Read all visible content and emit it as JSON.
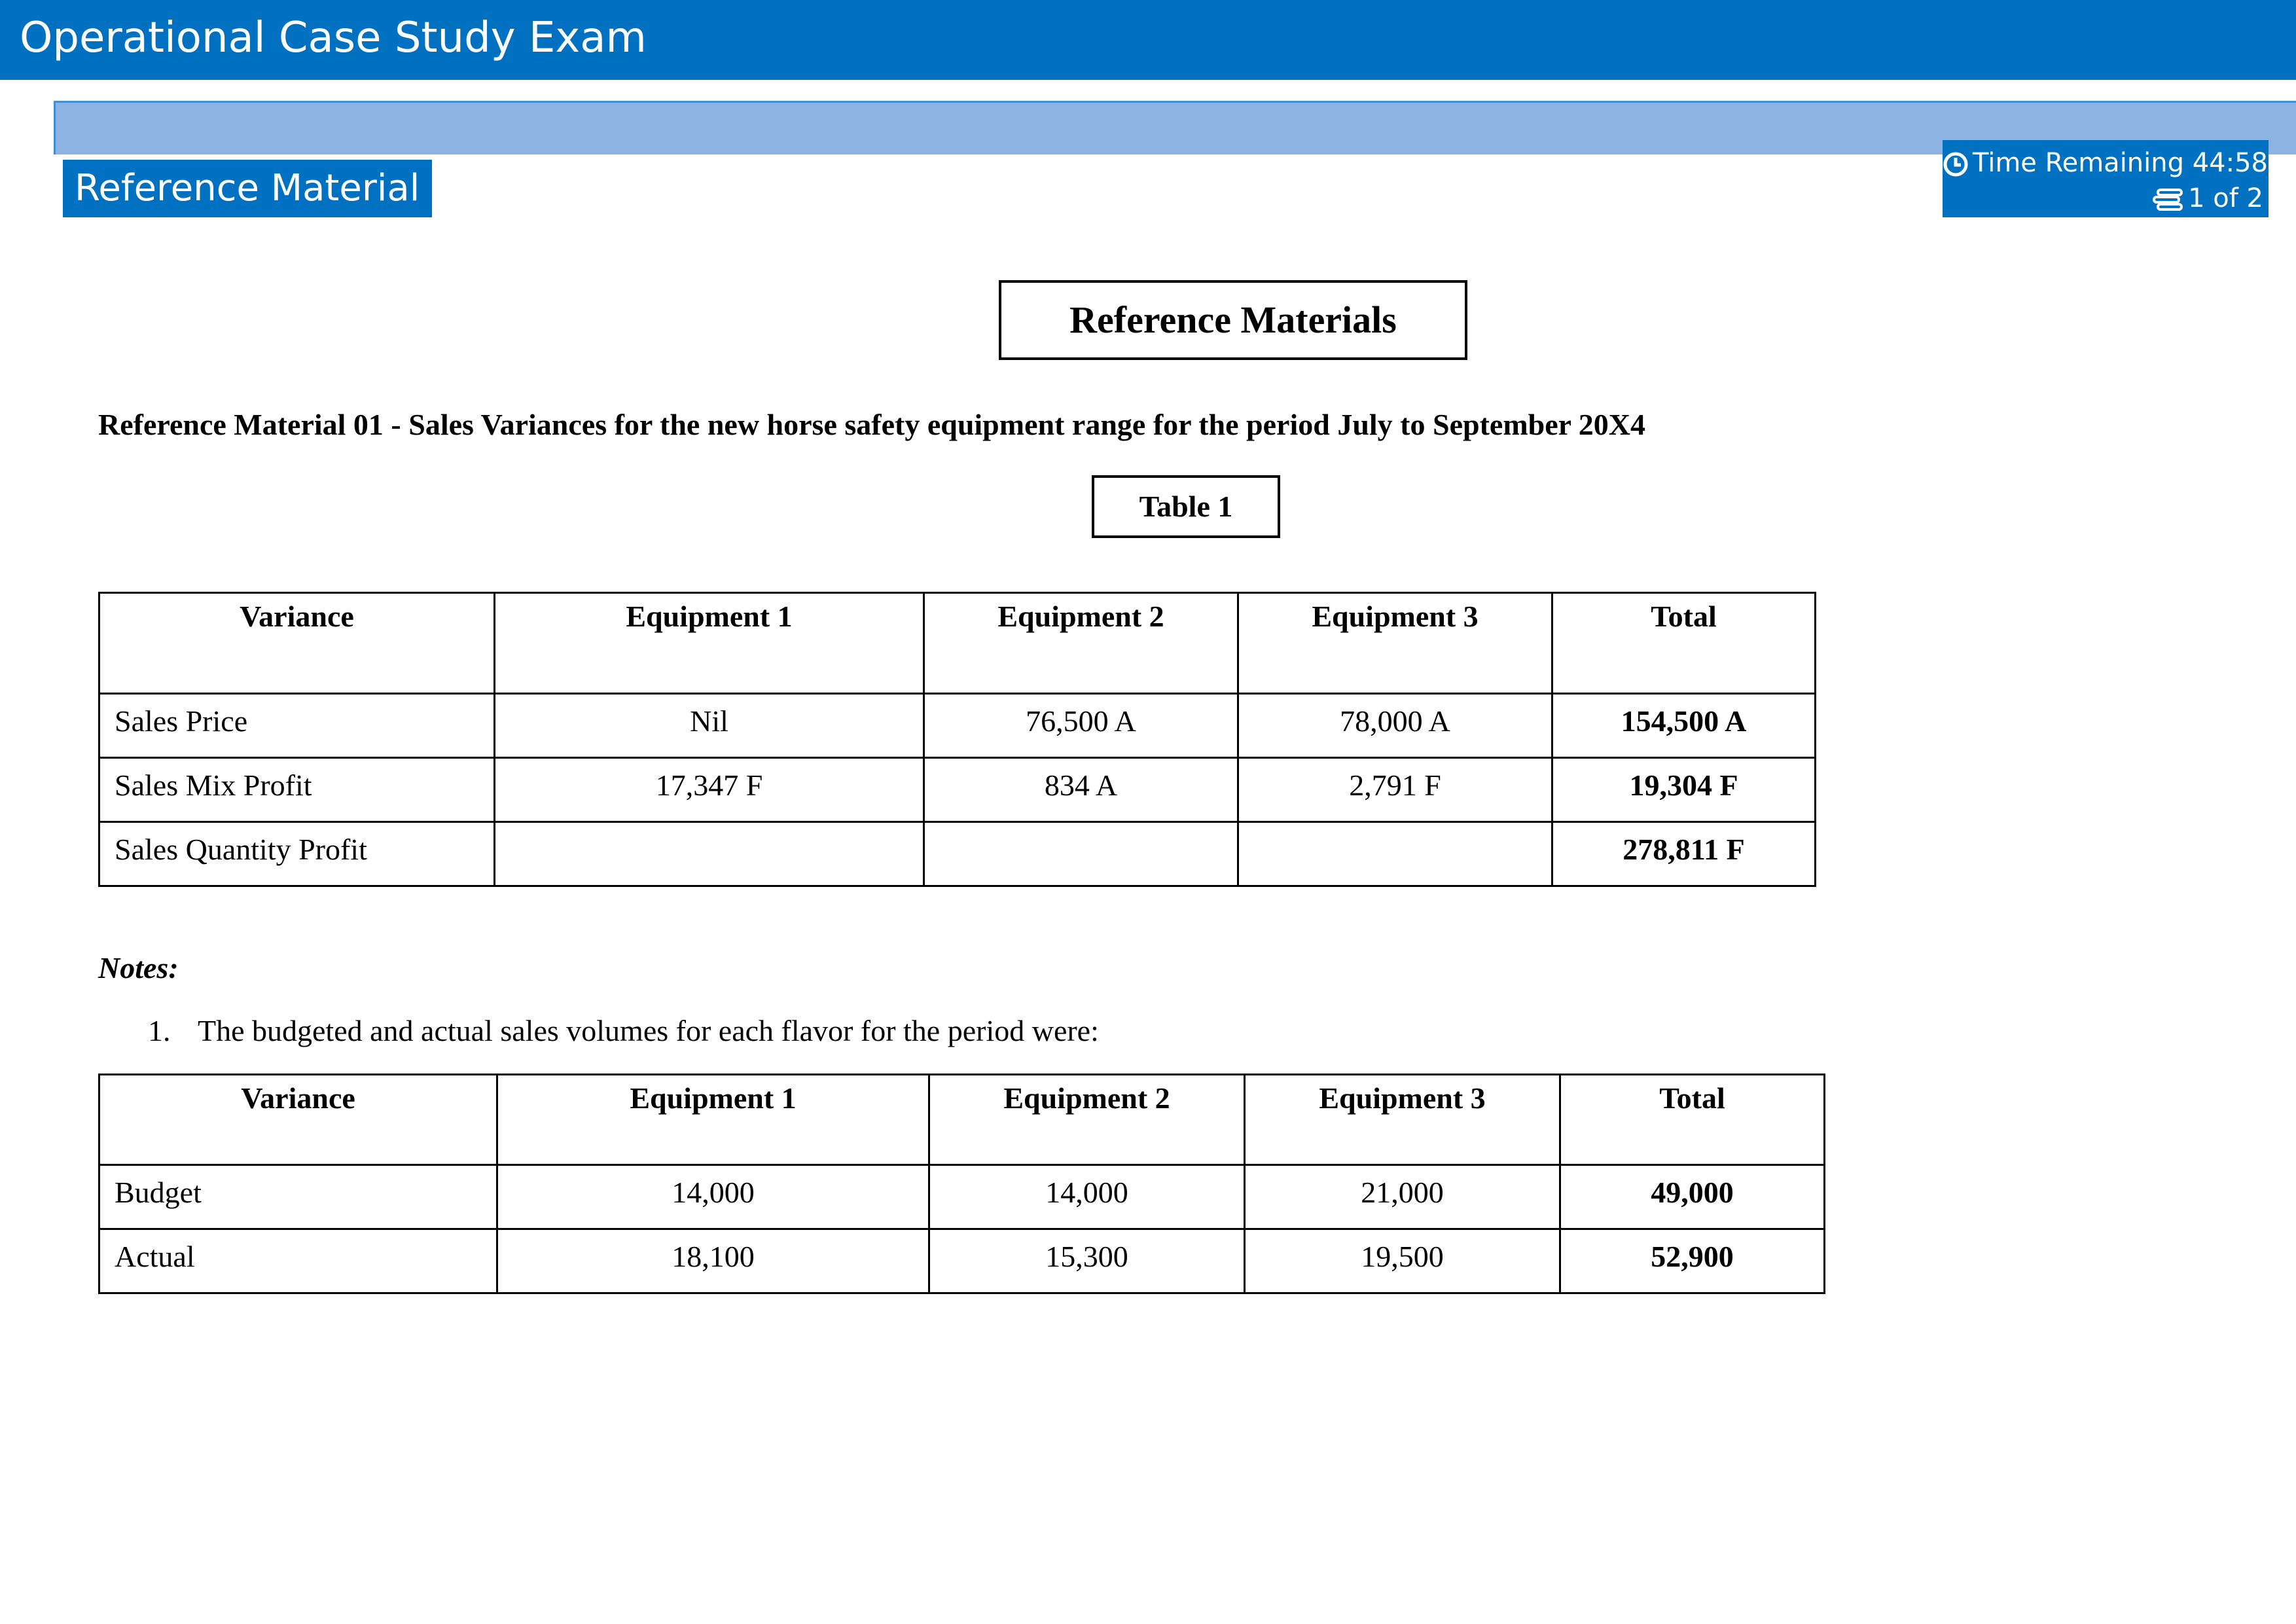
{
  "app": {
    "title": "Operational Case Study Exam"
  },
  "tab": {
    "label": "Reference Material"
  },
  "timer": {
    "label": "Time Remaining",
    "value": "44:58",
    "page": "1 of 2"
  },
  "document": {
    "title": "Reference Materials",
    "heading": "Reference Material 01 - Sales Variances for the new horse safety equipment range for the period July to September 20X4",
    "table1_label": "Table 1",
    "table1": {
      "headers": [
        "Variance",
        "Equipment 1",
        "Equipment 2",
        "Equipment 3",
        "Total"
      ],
      "rows": [
        [
          "Sales Price",
          "Nil",
          "76,500 A",
          "78,000 A",
          "154,500 A"
        ],
        [
          "Sales Mix Profit",
          "17,347 F",
          "834 A",
          "2,791 F",
          "19,304 F"
        ],
        [
          "Sales Quantity Profit",
          "",
          "",
          "",
          "278,811 F"
        ]
      ]
    },
    "notes_title": "Notes:",
    "notes": [
      {
        "num": "1.",
        "text": "The budgeted and actual sales volumes for each flavor for the period were:"
      }
    ],
    "table2": {
      "headers": [
        "Variance",
        "Equipment 1",
        "Equipment 2",
        "Equipment 3",
        "Total"
      ],
      "rows": [
        [
          "Budget",
          "14,000",
          "14,000",
          "21,000",
          "49,000"
        ],
        [
          "Actual",
          "18,100",
          "15,300",
          "19,500",
          "52,900"
        ]
      ]
    }
  },
  "colors": {
    "header_blue": "#0070c0",
    "subbar_blue": "#8db3e2"
  }
}
